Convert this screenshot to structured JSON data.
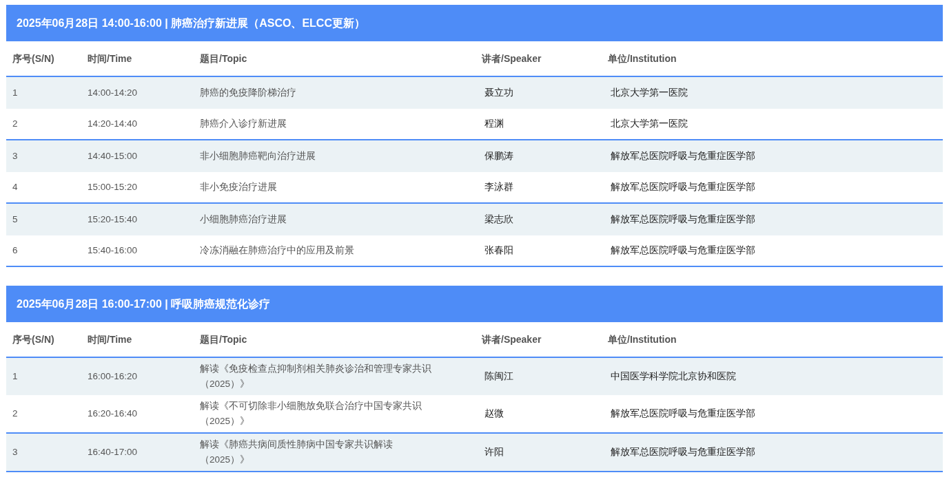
{
  "sessions": [
    {
      "title": "2025年06月28日 14:00-16:00 | 肺癌治疗新进展（ASCO、ELCC更新）",
      "columns": [
        "序号(S/N)",
        "时间/Time",
        "题目/Topic",
        "讲者/Speaker",
        "单位/Institution"
      ],
      "rows": [
        {
          "no": "1",
          "time": "14:00-14:20",
          "topic": "肺癌的免疫降阶梯治疗",
          "speaker": "聂立功",
          "institution": "北京大学第一医院"
        },
        {
          "no": "2",
          "time": "14:20-14:40",
          "topic": "肺癌介入诊疗新进展",
          "speaker": "程渊",
          "institution": "北京大学第一医院"
        },
        {
          "no": "3",
          "time": "14:40-15:00",
          "topic": "非小细胞肺癌靶向治疗进展",
          "speaker": "保鹏涛",
          "institution": "解放军总医院呼吸与危重症医学部"
        },
        {
          "no": "4",
          "time": "15:00-15:20",
          "topic": "非小免疫治疗进展",
          "speaker": "李泳群",
          "institution": "解放军总医院呼吸与危重症医学部"
        },
        {
          "no": "5",
          "time": "15:20-15:40",
          "topic": "小细胞肺癌治疗进展",
          "speaker": "梁志欣",
          "institution": "解放军总医院呼吸与危重症医学部"
        },
        {
          "no": "6",
          "time": "15:40-16:00",
          "topic": "冷冻消融在肺癌治疗中的应用及前景",
          "speaker": "张春阳",
          "institution": "解放军总医院呼吸与危重症医学部"
        }
      ]
    },
    {
      "title": "2025年06月28日 16:00-17:00 | 呼吸肺癌规范化诊疗",
      "columns": [
        "序号(S/N)",
        "时间/Time",
        "题目/Topic",
        "讲者/Speaker",
        "单位/Institution"
      ],
      "rows": [
        {
          "no": "1",
          "time": "16:00-16:20",
          "topic": "解读《免疫检查点抑制剂相关肺炎诊治和管理专家共识（2025）》",
          "speaker": "陈闽江",
          "institution": "中国医学科学院北京协和医院"
        },
        {
          "no": "2",
          "time": "16:20-16:40",
          "topic": "解读《不可切除非小细胞放免联合治疗中国专家共识（2025）》",
          "speaker": "赵微",
          "institution": "解放军总医院呼吸与危重症医学部"
        },
        {
          "no": "3",
          "time": "16:40-17:00",
          "topic": "解读《肺癌共病间质性肺病中国专家共识解读（2025）》",
          "speaker": "许阳",
          "institution": "解放军总医院呼吸与危重症医学部"
        }
      ]
    }
  ]
}
